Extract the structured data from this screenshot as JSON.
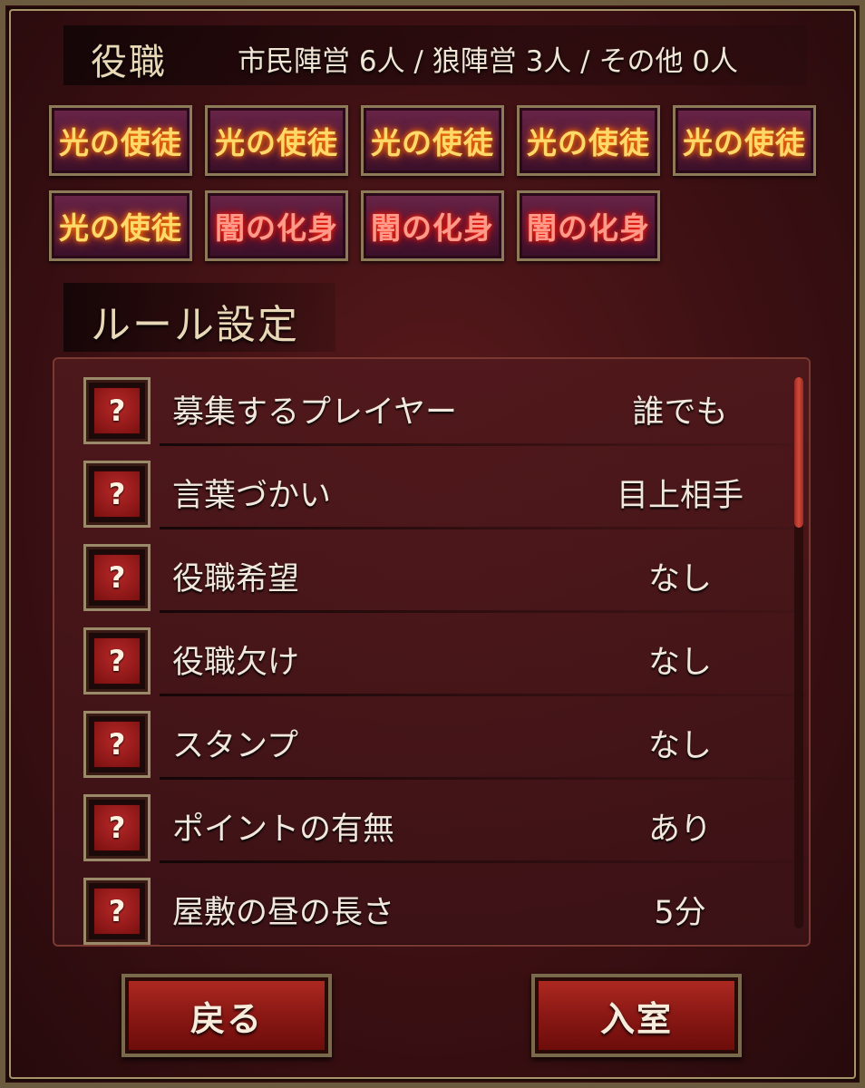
{
  "header": {
    "title": "役職",
    "summary": "市民陣営 6人 / 狼陣営 3人 / その他 0人"
  },
  "roles": [
    {
      "label": "光の使徒",
      "faction": "light"
    },
    {
      "label": "光の使徒",
      "faction": "light"
    },
    {
      "label": "光の使徒",
      "faction": "light"
    },
    {
      "label": "光の使徒",
      "faction": "light"
    },
    {
      "label": "光の使徒",
      "faction": "light"
    },
    {
      "label": "光の使徒",
      "faction": "light"
    },
    {
      "label": "闇の化身",
      "faction": "dark"
    },
    {
      "label": "闇の化身",
      "faction": "dark"
    },
    {
      "label": "闇の化身",
      "faction": "dark"
    }
  ],
  "rules": {
    "title": "ルール設定",
    "help_glyph": "?",
    "items": [
      {
        "name": "募集するプレイヤー",
        "value": "誰でも"
      },
      {
        "name": "言葉づかい",
        "value": "目上相手"
      },
      {
        "name": "役職希望",
        "value": "なし"
      },
      {
        "name": "役職欠け",
        "value": "なし"
      },
      {
        "name": "スタンプ",
        "value": "なし"
      },
      {
        "name": "ポイントの有無",
        "value": "あり"
      },
      {
        "name": "屋敷の昼の長さ",
        "value": "5分"
      }
    ]
  },
  "buttons": {
    "back": "戻る",
    "enter": "入室"
  },
  "colors": {
    "panel": "#3d1013",
    "light_role_text": "#ffd86a",
    "dark_role_text": "#ff9a8a",
    "button_red": "#8a1814"
  }
}
